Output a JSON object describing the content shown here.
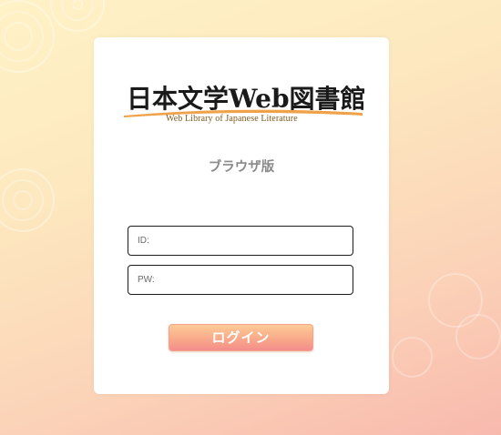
{
  "logo": {
    "title": "日本文学Web図書館",
    "subtitle": "Web Library of Japanese Literature"
  },
  "edition_label": "ブラウザ版",
  "form": {
    "id_placeholder": "ID:",
    "pw_placeholder": "PW:",
    "login_label": "ログイン"
  },
  "colors": {
    "button_top": "#fccb96",
    "button_bottom": "#f48d8b",
    "background_top": "#fff2c6",
    "background_bottom": "#f8b9ad"
  }
}
